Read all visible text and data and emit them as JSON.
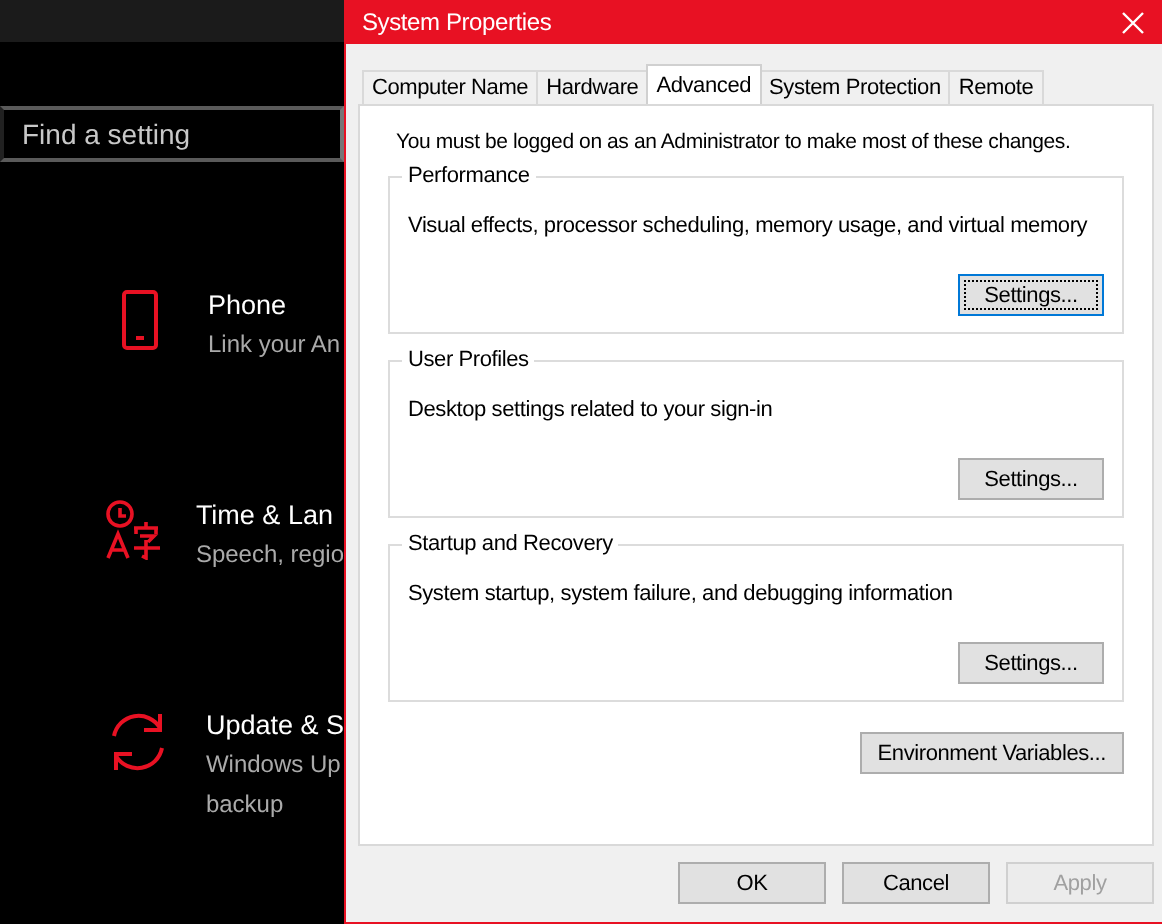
{
  "settings_app": {
    "search": {
      "placeholder": "Find a setting"
    },
    "items": [
      {
        "kind": "phone",
        "title": "Phone",
        "subtitle": [
          "Link your An"
        ]
      },
      {
        "kind": "time",
        "title": "Time & Lan",
        "subtitle": [
          "Speech, regio"
        ]
      },
      {
        "kind": "update",
        "title": "Update & S",
        "subtitle": [
          "Windows Up",
          "backup"
        ]
      }
    ]
  },
  "dialog": {
    "title": "System Properties",
    "tabs": [
      {
        "label": "Computer Name",
        "selected": false
      },
      {
        "label": "Hardware",
        "selected": false
      },
      {
        "label": "Advanced",
        "selected": true
      },
      {
        "label": "System Protection",
        "selected": false
      },
      {
        "label": "Remote",
        "selected": false
      }
    ],
    "notice": "You must be logged on as an Administrator to make most of these changes.",
    "groups": [
      {
        "title": "Performance",
        "text": "Visual effects, processor scheduling, memory usage, and virtual memory",
        "button": "Settings...",
        "focused": true
      },
      {
        "title": "User Profiles",
        "text": "Desktop settings related to your sign-in",
        "button": "Settings...",
        "focused": false
      },
      {
        "title": "Startup and Recovery",
        "text": "System startup, system failure, and debugging information",
        "button": "Settings...",
        "focused": false
      }
    ],
    "env_button": "Environment Variables...",
    "buttons": [
      {
        "label": "OK",
        "disabled": false
      },
      {
        "label": "Cancel",
        "disabled": false
      },
      {
        "label": "Apply",
        "disabled": true
      }
    ]
  }
}
